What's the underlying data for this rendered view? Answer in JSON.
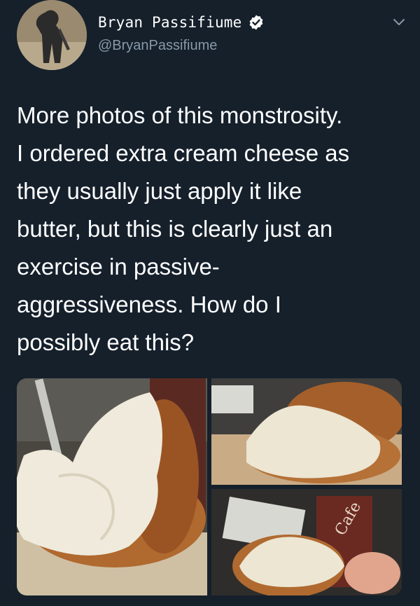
{
  "tweet": {
    "author_name": "Bryan Passifiume",
    "author_handle": "@BryanPassifiume",
    "verified": true,
    "text_lines": [
      "More photos of this monstrosity.",
      "I ordered extra cream cheese as",
      "they usually just apply it like",
      "butter, but this is clearly just an",
      "exercise in passive-",
      "aggressiveness. How do I",
      "possibly eat this?"
    ]
  },
  "icons": {
    "verified": "verified-badge-icon",
    "menu": "chevron-down-icon"
  },
  "colors": {
    "background": "#15202b",
    "secondary_text": "#8899a6",
    "verified_blue": "#1da1f2"
  }
}
